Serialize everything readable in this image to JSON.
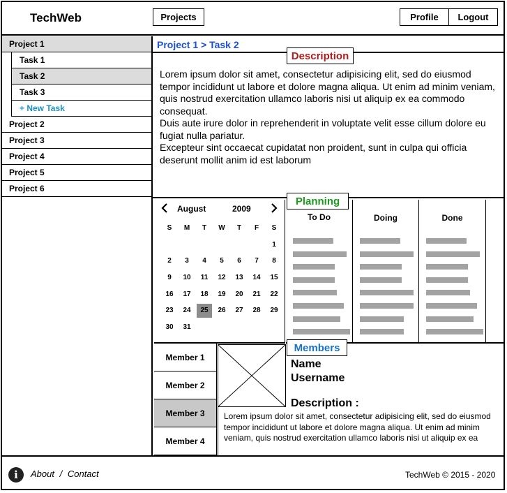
{
  "header": {
    "brand": "TechWeb",
    "projects_label": "Projects",
    "profile_label": "Profile",
    "logout_label": "Logout"
  },
  "sidebar": {
    "project1": "Project 1",
    "tasks": [
      "Task 1",
      "Task 2",
      "Task 3"
    ],
    "new_task": "+ New Task",
    "projects": [
      "Project 2",
      "Project 3",
      "Project 4",
      "Project 5",
      "Project 6"
    ],
    "active_project": "Project 1",
    "active_task": "Task 2"
  },
  "breadcrumb": "Project 1 > Task 2",
  "description": {
    "label": "Description",
    "paragraphs": [
      "Lorem ipsum dolor sit amet, consectetur adipisicing elit, sed do eiusmod tempor incididunt ut labore et dolore magna aliqua. Ut enim ad minim veniam, quis nostrud exercitation ullamco laboris nisi ut aliquip ex ea commodo consequat.",
      "Duis aute irure dolor in reprehenderit in voluptate velit esse cillum dolore eu fugiat nulla pariatur.",
      "Excepteur sint occaecat cupidatat non proident, sunt in culpa qui officia deserunt mollit anim id est laborum"
    ]
  },
  "calendar": {
    "month": "August",
    "year": "2009",
    "weekdays": [
      "S",
      "M",
      "T",
      "W",
      "T",
      "F",
      "S"
    ],
    "first_weekday": 6,
    "days_in_month": 31,
    "selected_day": 25,
    "prev_icon": "chevron-left-icon",
    "next_icon": "chevron-right-icon"
  },
  "planning": {
    "label": "Planning",
    "columns": [
      {
        "title": "To Do",
        "item_count": 8
      },
      {
        "title": "Doing",
        "item_count": 8
      },
      {
        "title": "Done",
        "item_count": 8
      }
    ],
    "placeholder_color": "#a3a3a3"
  },
  "members": {
    "label": "Members",
    "items": [
      "Member 1",
      "Member 2",
      "Member 3",
      "Member 4"
    ],
    "active": "Member 3",
    "name_label": "Name",
    "username_label": "Username",
    "description_label": "Description :",
    "description_text": "Lorem ipsum dolor sit amet, consectetur adipisicing elit, sed do eiusmod tempor incididunt ut labore et dolore magna aliqua. Ut enim ad minim veniam, quis nostrud exercitation ullamco laboris nisi ut aliquip ex ea"
  },
  "footer": {
    "info_icon": "info-icon",
    "about": "About",
    "separator": "/",
    "contact": "Contact",
    "copyright": "TechWeb © 2015 - 2020"
  },
  "colors": {
    "description_label": "#b01c1c",
    "planning_label": "#1d9a1d",
    "members_label": "#1a73c8",
    "breadcrumb": "#1a4fd6",
    "new_task": "#1e90c8",
    "selected": "#dcdcdc"
  }
}
